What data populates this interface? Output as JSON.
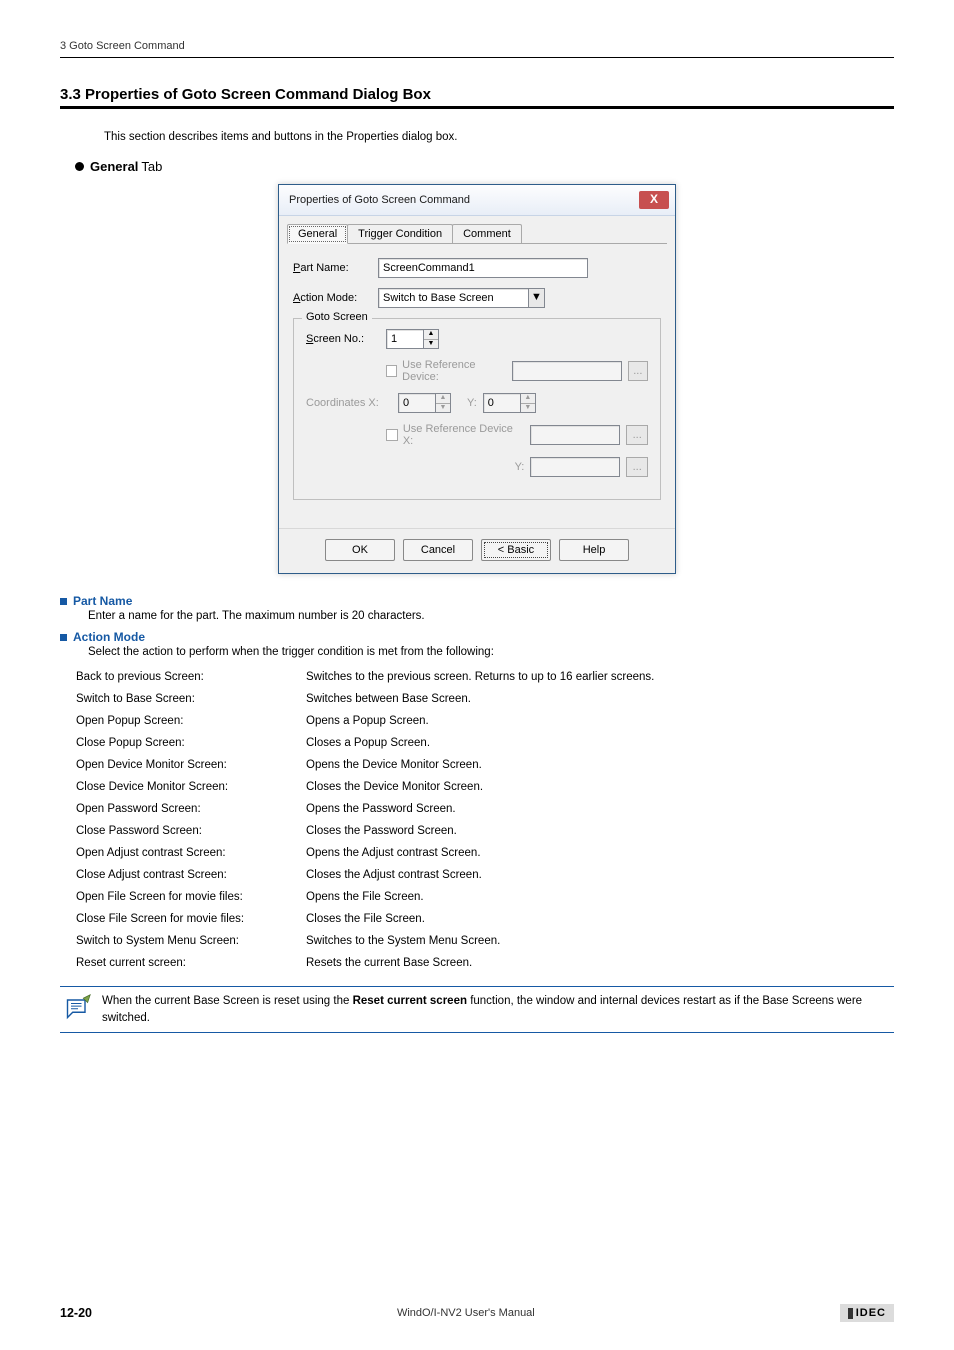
{
  "header": {
    "breadcrumb": "3 Goto Screen Command"
  },
  "section": {
    "number_title": "3.3   Properties of Goto Screen Command Dialog Box",
    "intro": "This section describes items and buttons in the Properties dialog box.",
    "bullet_label": "General",
    "bullet_sub": " Tab"
  },
  "dialog": {
    "title": "Properties of Goto Screen Command",
    "close_glyph": "X",
    "tabs": {
      "general": "General",
      "trigger": "Trigger Condition",
      "comment": "Comment"
    },
    "part_name_label_pre": "P",
    "part_name_label_post": "art Name:",
    "part_name_value": "ScreenCommand1",
    "action_mode_label_pre": "A",
    "action_mode_label_post": "ction Mode:",
    "action_mode_value": "Switch to Base Screen",
    "goto_legend": "Goto Screen",
    "screen_no_label_pre": "S",
    "screen_no_label_post": "creen No.:",
    "screen_no_value": "1",
    "use_ref_dev1": "Use Reference Device:",
    "coord_label_pre": "Coordinates ",
    "coord_x_u": "X",
    "coord_sep": ":",
    "coord_x_value": "0",
    "coord_y_pre": "Y",
    "coord_y_sep": ":",
    "coord_y_value": "0",
    "use_ref_dev2_pre": "Use ",
    "use_ref_dev2_u": "R",
    "use_ref_dev2_post": "eference Device   X:",
    "y_label": "Y:",
    "ellipsis": "...",
    "up": "▲",
    "down": "▼",
    "drop": "▼",
    "buttons": {
      "ok": "OK",
      "cancel": "Cancel",
      "basic_pre": "< ",
      "basic_u": "B",
      "basic_post": "asic",
      "help": "Help"
    }
  },
  "part_name": {
    "head": "Part Name",
    "text": "Enter a name for the part. The maximum number is 20 characters."
  },
  "action_mode": {
    "head": "Action Mode",
    "text": "Select the action to perform when the trigger condition is met from the following:",
    "rows": [
      {
        "l": "Back to previous Screen:",
        "r": "Switches to the previous screen. Returns to up to 16 earlier screens."
      },
      {
        "l": "Switch to Base Screen:",
        "r": "Switches between Base Screen."
      },
      {
        "l": "Open Popup Screen:",
        "r": "Opens a Popup Screen."
      },
      {
        "l": "Close Popup Screen:",
        "r": "Closes a Popup Screen."
      },
      {
        "l": "Open Device Monitor Screen:",
        "r": "Opens the Device Monitor Screen."
      },
      {
        "l": "Close Device Monitor Screen:",
        "r": "Closes the Device Monitor Screen."
      },
      {
        "l": "Open Password Screen:",
        "r": "Opens the Password Screen."
      },
      {
        "l": "Close Password Screen:",
        "r": "Closes the Password Screen."
      },
      {
        "l": "Open Adjust contrast Screen:",
        "r": "Opens the Adjust contrast Screen."
      },
      {
        "l": "Close Adjust contrast Screen:",
        "r": "Closes the Adjust contrast Screen."
      },
      {
        "l": "Open File Screen for movie files:",
        "r": "Opens the File Screen."
      },
      {
        "l": "Close File Screen for movie files:",
        "r": "Closes the File Screen."
      },
      {
        "l": "Switch to System Menu Screen:",
        "r": "Switches to the System Menu Screen."
      },
      {
        "l": "Reset current screen:",
        "r": "Resets the current Base Screen."
      }
    ]
  },
  "note": {
    "pre": "When the current Base Screen is reset using the ",
    "bold": "Reset current screen",
    "post": " function, the window and internal devices restart as if the Base Screens were switched."
  },
  "footer": {
    "page": "12-20",
    "manual": "WindO/I-NV2 User's Manual",
    "brand": "IDEC"
  }
}
